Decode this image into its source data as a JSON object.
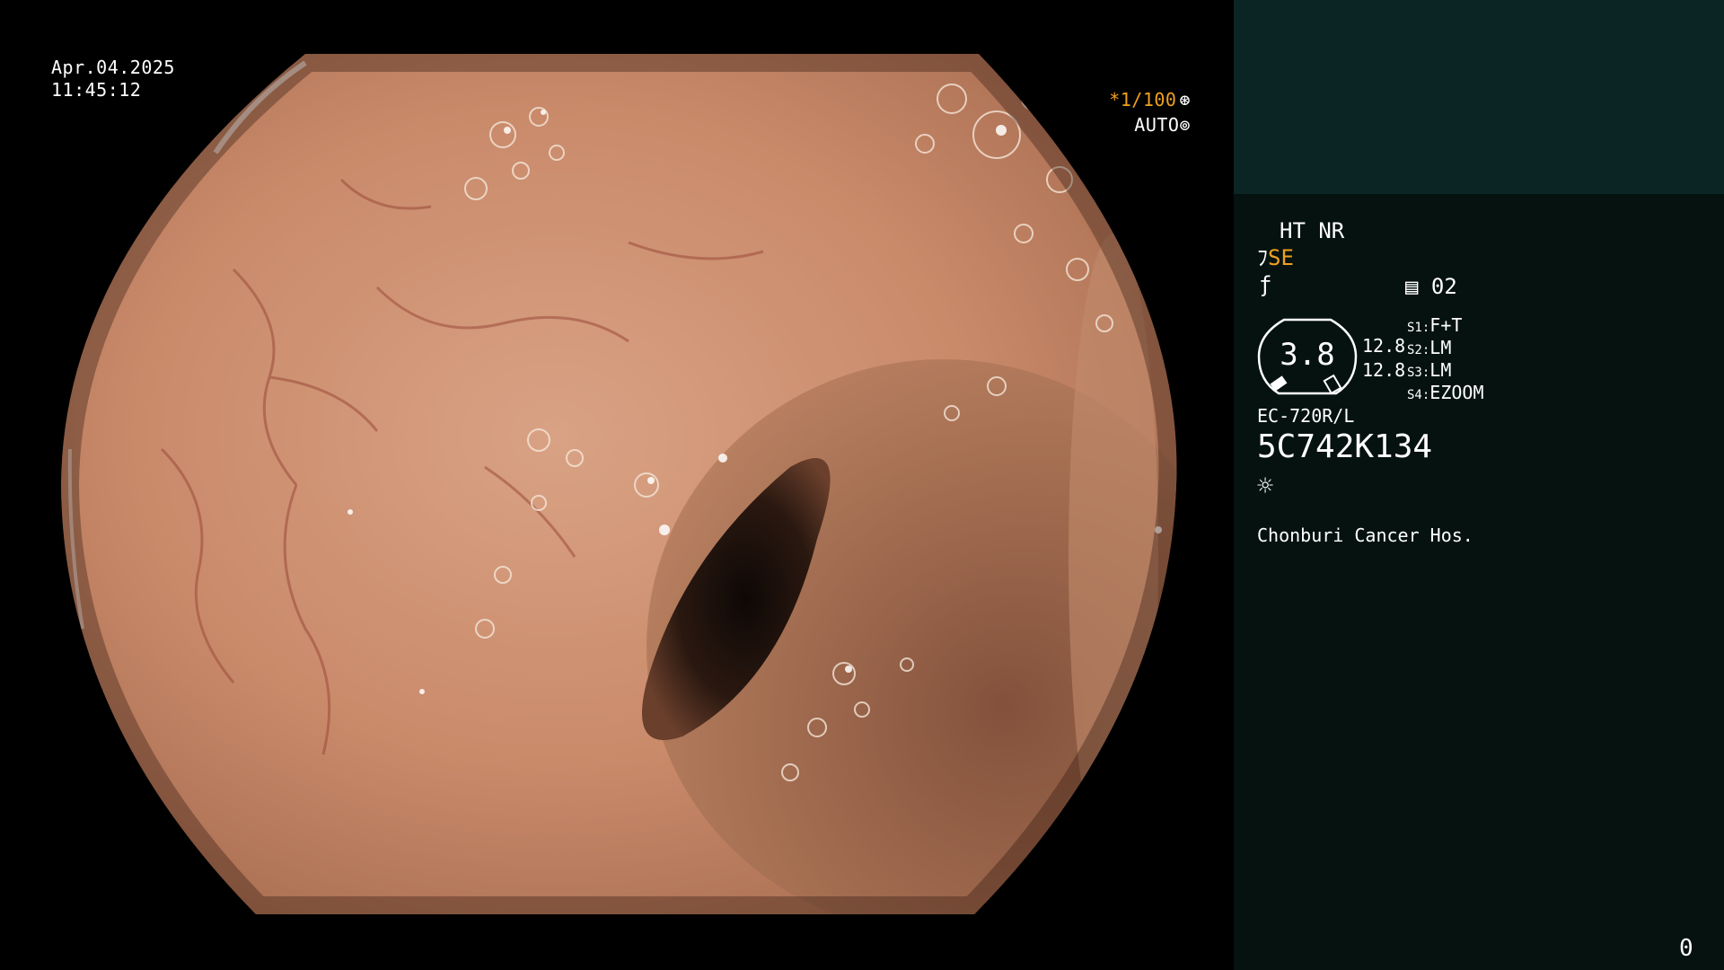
{
  "overlay": {
    "date": "Apr.04.2025",
    "time": "11:45:12",
    "shutter": "*1/100",
    "shutter_icon": "⊛",
    "iris": "AUTO",
    "iris_icon": "⊚"
  },
  "panel": {
    "ht_nr": "HT NR",
    "se_icon": "ﾌ",
    "se_label": "SE",
    "f_icon": "ƒ",
    "channel_icon": "▤",
    "channel": "02",
    "dial_value": "3.8",
    "value_a": "12.8",
    "value_b": "12.8",
    "switches": [
      {
        "label": "S1:",
        "value": "F+T"
      },
      {
        "label": "S2:",
        "value": "LM"
      },
      {
        "label": "S3:",
        "value": "LM"
      },
      {
        "label": "S4:",
        "value": "EZOOM"
      }
    ],
    "model": "EC-720R/L",
    "serial": "5C742K134",
    "light_icon": "☼",
    "hospital": "Chonburi Cancer Hos.",
    "counter": "0"
  },
  "colors": {
    "accent": "#f0a020",
    "panel_top": "#0b2424",
    "panel_bottom": "#051210"
  }
}
